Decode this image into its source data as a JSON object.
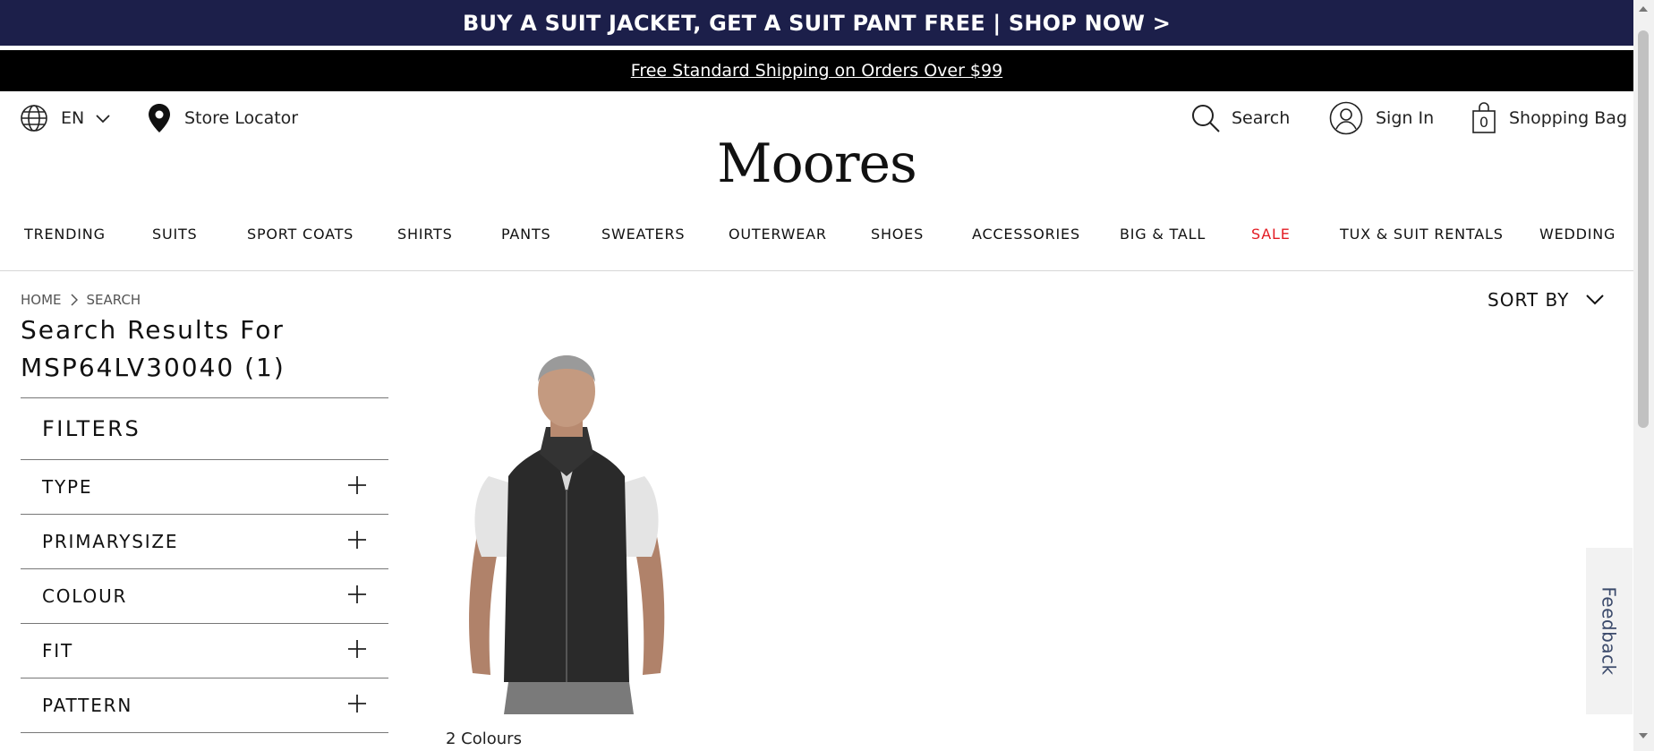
{
  "promo": {
    "text": "BUY A SUIT JACKET, GET A SUIT PANT FREE | SHOP NOW >"
  },
  "shipping": {
    "text": "Free Standard Shipping on Orders Over $99"
  },
  "utility": {
    "language": "EN",
    "store_locator": "Store Locator",
    "search": "Search",
    "sign_in": "Sign In",
    "bag_count": "0",
    "shopping_bag": "Shopping Bag"
  },
  "brand": {
    "logo": "Moores"
  },
  "nav": {
    "items": [
      {
        "label": "TRENDING"
      },
      {
        "label": "SUITS"
      },
      {
        "label": "SPORT COATS"
      },
      {
        "label": "SHIRTS"
      },
      {
        "label": "PANTS"
      },
      {
        "label": "SWEATERS"
      },
      {
        "label": "OUTERWEAR"
      },
      {
        "label": "SHOES"
      },
      {
        "label": "ACCESSORIES"
      },
      {
        "label": "BIG & TALL"
      },
      {
        "label": "SALE"
      },
      {
        "label": "TUX & SUIT RENTALS"
      },
      {
        "label": "WEDDING"
      }
    ],
    "sale_color": "#e31b23"
  },
  "breadcrumb": {
    "home": "HOME",
    "current": "SEARCH"
  },
  "results": {
    "title_line1": "Search Results For",
    "title_line2": "MSP64LV30040 (1)"
  },
  "filters": {
    "heading": "FILTERS",
    "items": [
      {
        "label": "TYPE"
      },
      {
        "label": "PRIMARYSIZE"
      },
      {
        "label": "COLOUR"
      },
      {
        "label": "FIT"
      },
      {
        "label": "PATTERN"
      }
    ]
  },
  "sort": {
    "label": "SORT BY"
  },
  "product": {
    "colours": "2 Colours"
  },
  "feedback": {
    "label": "Feedback"
  },
  "colors": {
    "promo_bg": "#1c1f4a",
    "shipping_bg": "#000000"
  }
}
